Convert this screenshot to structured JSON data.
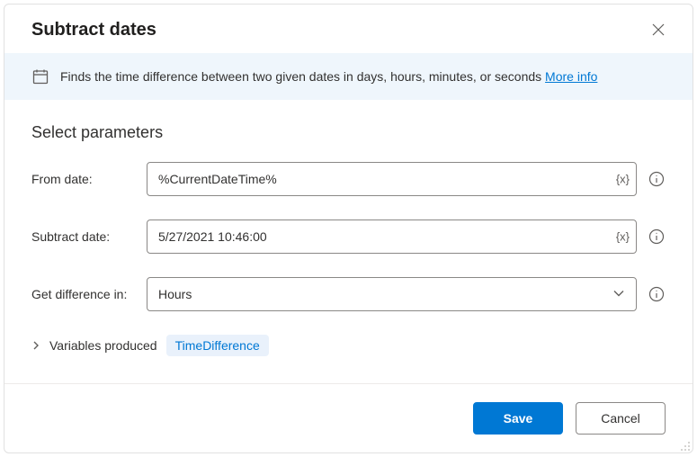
{
  "dialog": {
    "title": "Subtract dates"
  },
  "banner": {
    "text": "Finds the time difference between two given dates in days, hours, minutes, or seconds ",
    "link": "More info"
  },
  "section": {
    "title": "Select parameters"
  },
  "fields": {
    "fromDate": {
      "label": "From date:",
      "value": "%CurrentDateTime%",
      "varToken": "{x}"
    },
    "subtractDate": {
      "label": "Subtract date:",
      "value": "5/27/2021 10:46:00",
      "varToken": "{x}"
    },
    "getDifference": {
      "label": "Get difference in:",
      "value": "Hours"
    }
  },
  "variables": {
    "label": "Variables produced",
    "chip": "TimeDifference"
  },
  "footer": {
    "save": "Save",
    "cancel": "Cancel"
  }
}
